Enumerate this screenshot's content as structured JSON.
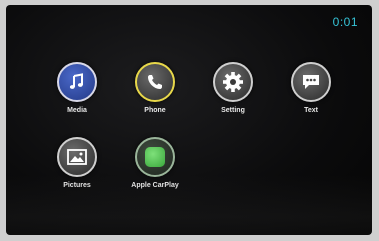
{
  "status": {
    "clock": "0:01"
  },
  "apps": [
    {
      "label": "Media",
      "icon": "music-note-icon"
    },
    {
      "label": "Phone",
      "icon": "phone-handset-icon"
    },
    {
      "label": "Setting",
      "icon": "gear-icon"
    },
    {
      "label": "Text",
      "icon": "speech-bubble-icon"
    },
    {
      "label": "Pictures",
      "icon": "picture-icon"
    },
    {
      "label": "Apple CarPlay",
      "icon": "carplay-icon"
    }
  ],
  "colors": {
    "clock": "#36c3d6",
    "phone_ring": "#e8d84a",
    "media_fill": "#3b5bbd",
    "carplay_green": "#5cc95a"
  }
}
